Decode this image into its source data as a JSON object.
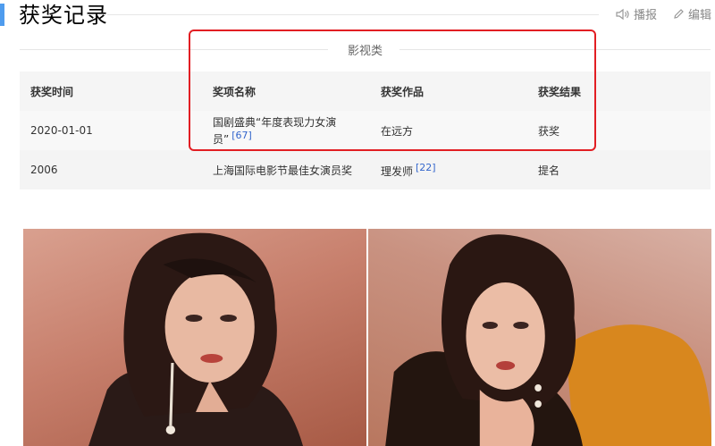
{
  "header": {
    "title": "获奖记录",
    "tools": {
      "broadcast_label": "播报",
      "edit_label": "编辑"
    }
  },
  "section": {
    "label": "影视类"
  },
  "table": {
    "columns": [
      "获奖时间",
      "奖项名称",
      "获奖作品",
      "获奖结果"
    ],
    "rows": [
      {
        "date": "2020-01-01",
        "award": "国剧盛典“年度表现力女演员”",
        "award_ref": "[67]",
        "work": "在远方",
        "work_ref": "",
        "result": "获奖"
      },
      {
        "date": "2006",
        "award": "上海国际电影节最佳女演员奖",
        "award_ref": "",
        "work": "理发师",
        "work_ref": "[22]",
        "result": "提名"
      }
    ]
  },
  "colors": {
    "accent": "#4f9cee",
    "highlight": "#e21e23",
    "link": "#3366cc"
  }
}
